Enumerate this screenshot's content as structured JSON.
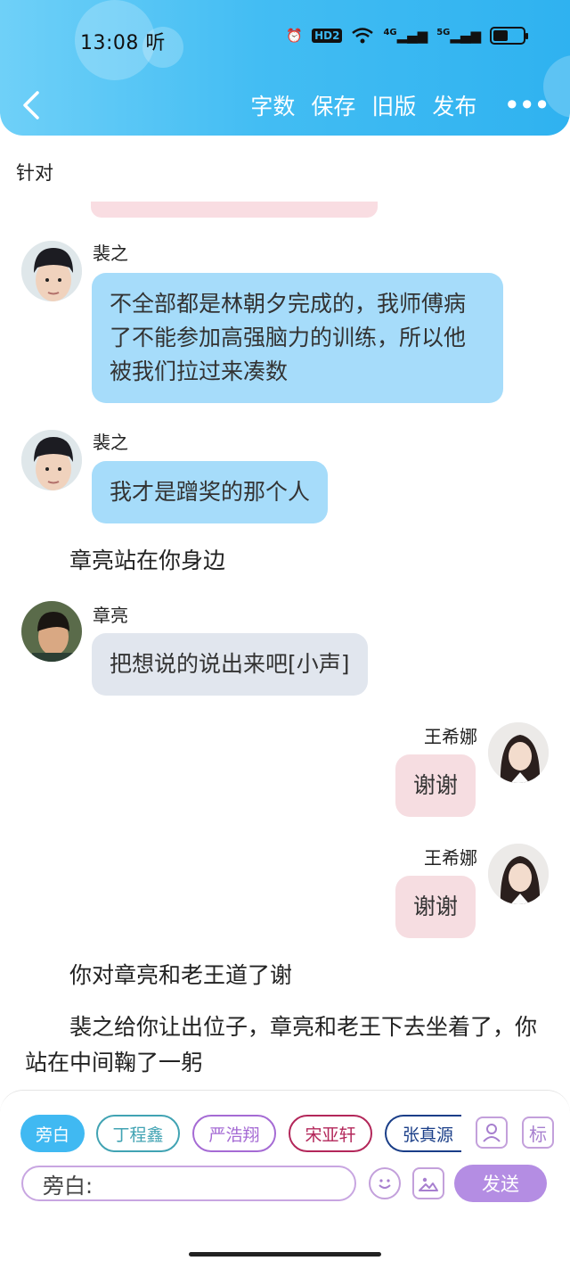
{
  "status_bar": {
    "time": "13:08",
    "time_suffix": "听",
    "hd": "HD2",
    "net1": "4G",
    "net2": "5G"
  },
  "header": {
    "actions": [
      "字数",
      "保存",
      "旧版",
      "发布"
    ],
    "more": "•••"
  },
  "context_label": "针对",
  "messages": [
    {
      "name": "裴之",
      "text": "不全部都是林朝夕完成的，我师傅病了不能参加高强脑力的训练，所以他被我们拉过来凑数"
    },
    {
      "name": "裴之",
      "text": "我才是蹭奖的那个人"
    },
    {
      "narration": "章亮站在你身边"
    },
    {
      "name": "章亮",
      "text": "把想说的说出来吧[小声]"
    },
    {
      "name": "王希娜",
      "text": "谢谢"
    },
    {
      "name": "王希娜",
      "text": "谢谢"
    },
    {
      "narration": "你对章亮和老王道了谢"
    },
    {
      "narration": "裴之给你让出位子，章亮和老王下去坐着了，你站在中间鞠了一躬"
    }
  ],
  "bottom": {
    "chips": [
      "旁白",
      "丁程鑫",
      "严浩翔",
      "宋亚轩",
      "张真源"
    ],
    "tag_button": "标",
    "input_value": "旁白:",
    "send_label": "发送"
  },
  "colors": {
    "header_start": "#6fd0f8",
    "header_end": "#2fb2f0",
    "bubble_blue": "#a6dcfa",
    "bubble_gray": "#e1e6ee",
    "bubble_pink": "#f6dde1",
    "send": "#b48de3"
  }
}
